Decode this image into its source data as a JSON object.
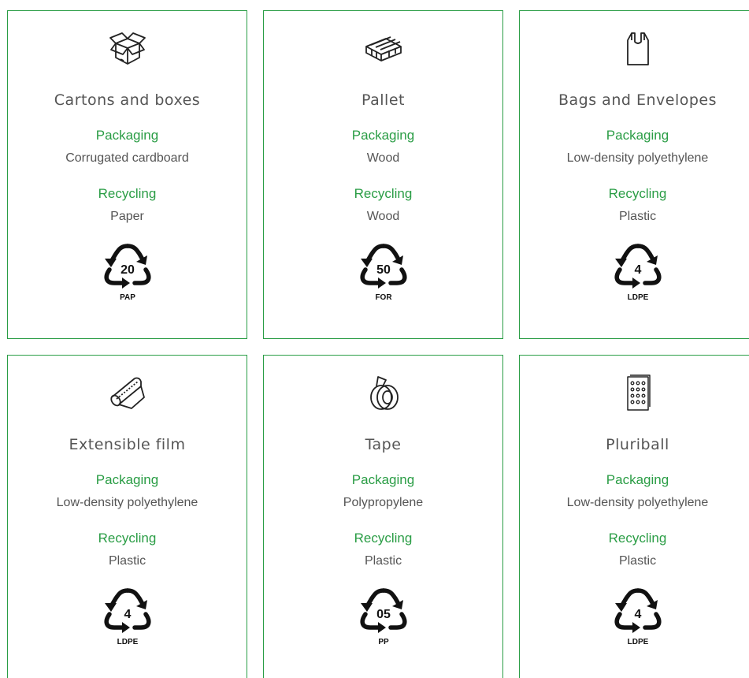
{
  "cards": [
    {
      "title": "Cartons and boxes",
      "packaging_label": "Packaging",
      "packaging": "Corrugated cardboard",
      "recycling_label": "Recycling",
      "recycling": "Paper",
      "code_number": "20",
      "code": "PAP",
      "icon": "box-icon"
    },
    {
      "title": "Pallet",
      "packaging_label": "Packaging",
      "packaging": "Wood",
      "recycling_label": "Recycling",
      "recycling": "Wood",
      "code_number": "50",
      "code": "FOR",
      "icon": "pallet-icon"
    },
    {
      "title": "Bags and Envelopes",
      "packaging_label": "Packaging",
      "packaging": "Low-density polyethylene",
      "recycling_label": "Recycling",
      "recycling": "Plastic",
      "code_number": "4",
      "code": "LDPE",
      "icon": "bag-icon"
    },
    {
      "title": "Extensible film",
      "packaging_label": "Packaging",
      "packaging": "Low-density polyethylene",
      "recycling_label": "Recycling",
      "recycling": "Plastic",
      "code_number": "4",
      "code": "LDPE",
      "icon": "film-roll-icon"
    },
    {
      "title": "Tape",
      "packaging_label": "Packaging",
      "packaging": "Polypropylene",
      "recycling_label": "Recycling",
      "recycling": "Plastic",
      "code_number": "05",
      "code": "PP",
      "icon": "tape-icon"
    },
    {
      "title": "Pluriball",
      "packaging_label": "Packaging",
      "packaging": "Low-density polyethylene",
      "recycling_label": "Recycling",
      "recycling": "Plastic",
      "code_number": "4",
      "code": "LDPE",
      "icon": "bubble-wrap-icon"
    }
  ],
  "colors": {
    "accent": "#2a9d45",
    "text": "#555555"
  }
}
